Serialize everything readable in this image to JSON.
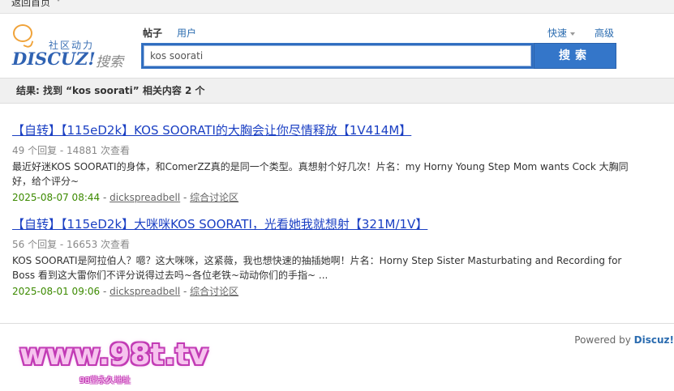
{
  "topbar": {
    "back_label": "返回首页"
  },
  "logo": {
    "subtitle": "社区动力",
    "brand": "DISCUZ!",
    "brand_suffix": "搜索"
  },
  "search": {
    "tabs": [
      {
        "label": "帖子",
        "active": true
      },
      {
        "label": "用户",
        "active": false
      }
    ],
    "quick_label": "快速",
    "advanced_label": "高级",
    "query": "kos soorati",
    "button_label": "搜索"
  },
  "summary": "结果: 找到 “kos soorati” 相关内容 2 个",
  "results": [
    {
      "title": "【自转】【115eD2k】KOS SOORATI的大胸会让你尽情释放【1V414M】",
      "meta": "49 个回复 - 14881 次查看",
      "snippet": "最近好迷KOS SOORATI的身体，和ComerZZ真的是同一个类型。真想射个好几次！片名：my Horny Young Step Mom wants Cock 大胸同好，给个评分~",
      "date": "2025-08-07 08:44",
      "author": "dickspreadbell",
      "forum": "综合讨论区"
    },
    {
      "title": "【自转】【115eD2k】大咪咪KOS SOORATI，光看她我就想射【321M/1V】",
      "meta": "56 个回复 - 16653 次查看",
      "snippet": "KOS SOORATI是阿拉伯人？嗯？这大咪咪，这紧薇，我也想快速的抽插她啊！片名：Horny Step Sister Masturbating and Recording for Boss 看到这大雷你们不评分说得过去吗~各位老铁~动动你们的手指~ ...",
      "date": "2025-08-01 09:06",
      "author": "dickspreadbell",
      "forum": "综合讨论区"
    }
  ],
  "footer": {
    "powered_prefix": "Powered by",
    "powered_brand": "Discuz!"
  },
  "watermark": {
    "url": "www.98t.tv",
    "tagline": "98堂永久地址"
  },
  "colors": {
    "link": "#1a3fc3",
    "accent": "#3476c9",
    "date": "#3c8a00"
  }
}
